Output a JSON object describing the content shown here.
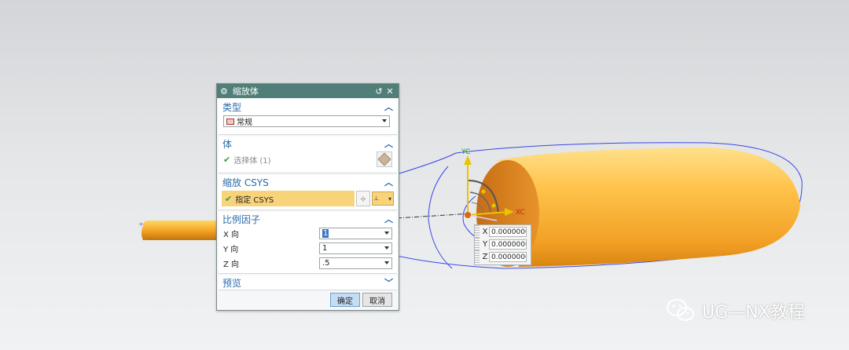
{
  "dialog": {
    "title": "缩放体",
    "sections": {
      "type": {
        "label": "类型",
        "value": "常规"
      },
      "body": {
        "label": "体",
        "select_label": "选择体 (1)"
      },
      "csys": {
        "label": "缩放 CSYS",
        "specify_label": "指定 CSYS"
      },
      "factors": {
        "label": "比例因子",
        "rows": [
          {
            "label": "X 向",
            "value": "1"
          },
          {
            "label": "Y 向",
            "value": "1"
          },
          {
            "label": "Z 向",
            "value": ".5"
          }
        ]
      },
      "preview": {
        "label": "预览"
      }
    },
    "buttons": {
      "ok": "确定",
      "cancel": "取消"
    }
  },
  "viewport": {
    "axis_labels": {
      "y": "YC",
      "x": "XC"
    },
    "coords": [
      {
        "label": "X",
        "value": "0.00000000"
      },
      {
        "label": "Y",
        "value": "0.00000000"
      },
      {
        "label": "Z",
        "value": "0.00000000"
      }
    ]
  },
  "watermark": {
    "text": "UG—NX教程"
  },
  "colors": {
    "titlebar": "#4f7f78",
    "section_header": "#2b6aa8",
    "highlight": "#f9d37a",
    "body_orange": "#f5a623"
  }
}
